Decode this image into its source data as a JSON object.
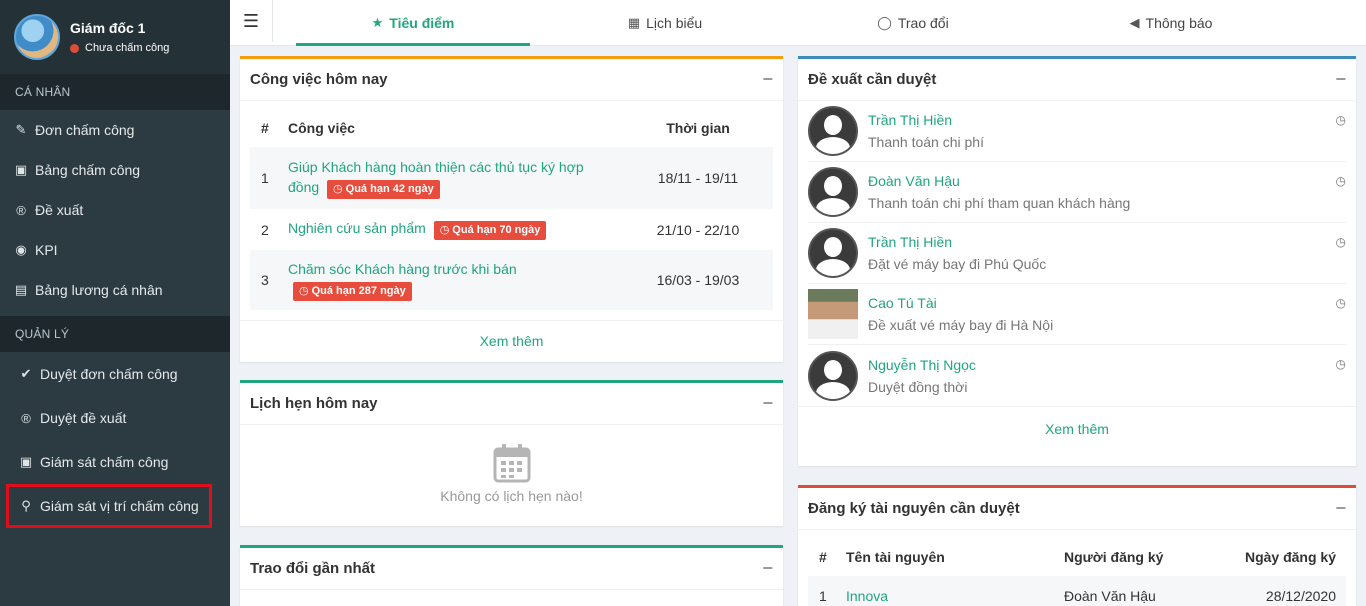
{
  "profile": {
    "name": "Giám đốc 1",
    "status": "Chưa chấm công"
  },
  "sidebar": {
    "personal_heading": "CÁ NHÂN",
    "personal_items": [
      {
        "label": "Đơn chấm công",
        "icon": "edit-icon"
      },
      {
        "label": "Bảng chấm công",
        "icon": "calendar-check-icon"
      },
      {
        "label": "Đề xuất",
        "icon": "registered-icon"
      },
      {
        "label": "KPI",
        "icon": "eye-icon"
      },
      {
        "label": "Bảng lương cá nhân",
        "icon": "money-icon"
      }
    ],
    "manage_heading": "QUẢN LÝ",
    "manage_items": [
      {
        "label": "Duyệt đơn chấm công",
        "icon": "check-circle-icon"
      },
      {
        "label": "Duyệt đề xuất",
        "icon": "registered-icon"
      },
      {
        "label": "Giám sát chấm công",
        "icon": "calendar-check-icon"
      },
      {
        "label": "Giám sát vị trí chấm công",
        "icon": "map-marker-icon"
      }
    ]
  },
  "tabs": [
    {
      "label": "Tiêu điểm",
      "icon": "star-icon",
      "active": true
    },
    {
      "label": "Lịch biểu",
      "icon": "calendar-icon",
      "active": false
    },
    {
      "label": "Trao đổi",
      "icon": "comment-icon",
      "active": false
    },
    {
      "label": "Thông báo",
      "icon": "bullhorn-icon",
      "active": false
    }
  ],
  "tasks_today": {
    "title": "Công việc hôm nay",
    "columns": [
      "#",
      "Công việc",
      "Thời gian"
    ],
    "rows": [
      {
        "no": "1",
        "task_line1": "Giúp Khách hàng hoàn thiện các thủ tục ký hợp",
        "task_line2": "đồng",
        "badge": "Quá hạn 42 ngày",
        "time": "18/11 - 19/11"
      },
      {
        "no": "2",
        "task": "Nghiên cứu sản phẩm",
        "badge": "Quá hạn 70 ngày",
        "time": "21/10 - 22/10"
      },
      {
        "no": "3",
        "task": "Chăm sóc Khách hàng trước khi bán",
        "badge": "Quá hạn 287 ngày",
        "time": "16/03 - 19/03"
      }
    ],
    "see_more": "Xem thêm"
  },
  "appointments": {
    "title": "Lịch hẹn hôm nay",
    "empty": "Không có lịch hẹn nào!"
  },
  "recent_discussions": {
    "title": "Trao đổi gần nhất"
  },
  "proposals": {
    "title": "Đề xuất cần duyệt",
    "items": [
      {
        "name": "Trần Thị Hiền",
        "desc": "Thanh toán chi phí"
      },
      {
        "name": "Đoàn Văn Hậu",
        "desc": "Thanh toán chi phí tham quan khách hàng"
      },
      {
        "name": "Trần Thị Hiền",
        "desc": "Đặt vé máy bay đi Phú Quốc"
      },
      {
        "name": "Cao Tú Tài",
        "desc": "Đề xuất vé máy bay đi Hà Nội"
      },
      {
        "name": "Nguyễn Thị Ngọc",
        "desc": "Duyệt đồng thời"
      }
    ],
    "see_more": "Xem thêm"
  },
  "resources": {
    "title": "Đăng ký tài nguyên cần duyệt",
    "columns": [
      "#",
      "Tên tài nguyên",
      "Người đăng ký",
      "Ngày đăng ký"
    ],
    "rows": [
      {
        "no": "1",
        "name": "Innova",
        "user": "Đoàn Văn Hậu",
        "date": "28/12/2020"
      }
    ]
  },
  "colors": {
    "accent": "#20a57f",
    "sidebar": "#2c3b41",
    "danger": "#e74c3c",
    "highlight": "#e00d1b",
    "panel_orange": "#f39c12",
    "panel_blue": "#3c8dbc",
    "panel_red": "#dd4b39"
  }
}
